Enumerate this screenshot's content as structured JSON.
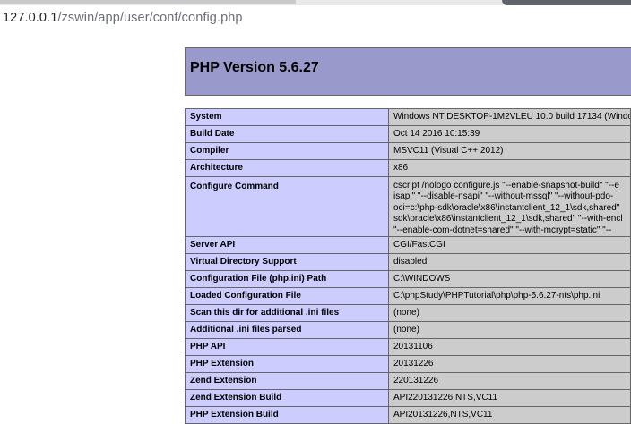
{
  "browser": {
    "url_host": "127.0.0.1",
    "url_path": "/zswin/app/user/conf/config.php"
  },
  "page": {
    "title": "PHP Version 5.6.27"
  },
  "rows": [
    {
      "label": "System",
      "value": "Windows NT DESKTOP-1M2VLEU 10.0 build 17134 (Windo"
    },
    {
      "label": "Build Date",
      "value": "Oct 14 2016 10:15:39"
    },
    {
      "label": "Compiler",
      "value": "MSVC11 (Visual C++ 2012)"
    },
    {
      "label": "Architecture",
      "value": "x86"
    },
    {
      "label": "Configure Command",
      "value_lines": [
        "cscript /nologo configure.js \"--enable-snapshot-build\" \"--e",
        "isapi\" \"--disable-nsapi\" \"--without-mssql\" \"--without-pdo-",
        "oci=c:\\php-sdk\\oracle\\x86\\instantclient_12_1\\sdk,shared\"",
        "sdk\\oracle\\x86\\instantclient_12_1\\sdk,shared\" \"--with-encl",
        "\"--enable-com-dotnet=shared\" \"--with-mcrypt=static\" \"--"
      ]
    },
    {
      "label": "Server API",
      "value": "CGI/FastCGI"
    },
    {
      "label": "Virtual Directory Support",
      "value": "disabled"
    },
    {
      "label": "Configuration File (php.ini) Path",
      "value": "C:\\WINDOWS"
    },
    {
      "label": "Loaded Configuration File",
      "value": "C:\\phpStudy\\PHPTutorial\\php\\php-5.6.27-nts\\php.ini"
    },
    {
      "label": "Scan this dir for additional .ini files",
      "value": "(none)"
    },
    {
      "label": "Additional .ini files parsed",
      "value": "(none)"
    },
    {
      "label": "PHP API",
      "value": "20131106"
    },
    {
      "label": "PHP Extension",
      "value": "20131226"
    },
    {
      "label": "Zend Extension",
      "value": "220131226"
    },
    {
      "label": "Zend Extension Build",
      "value": "API220131226,NTS,VC11"
    },
    {
      "label": "PHP Extension Build",
      "value": "API20131226,NTS,VC11"
    }
  ]
}
